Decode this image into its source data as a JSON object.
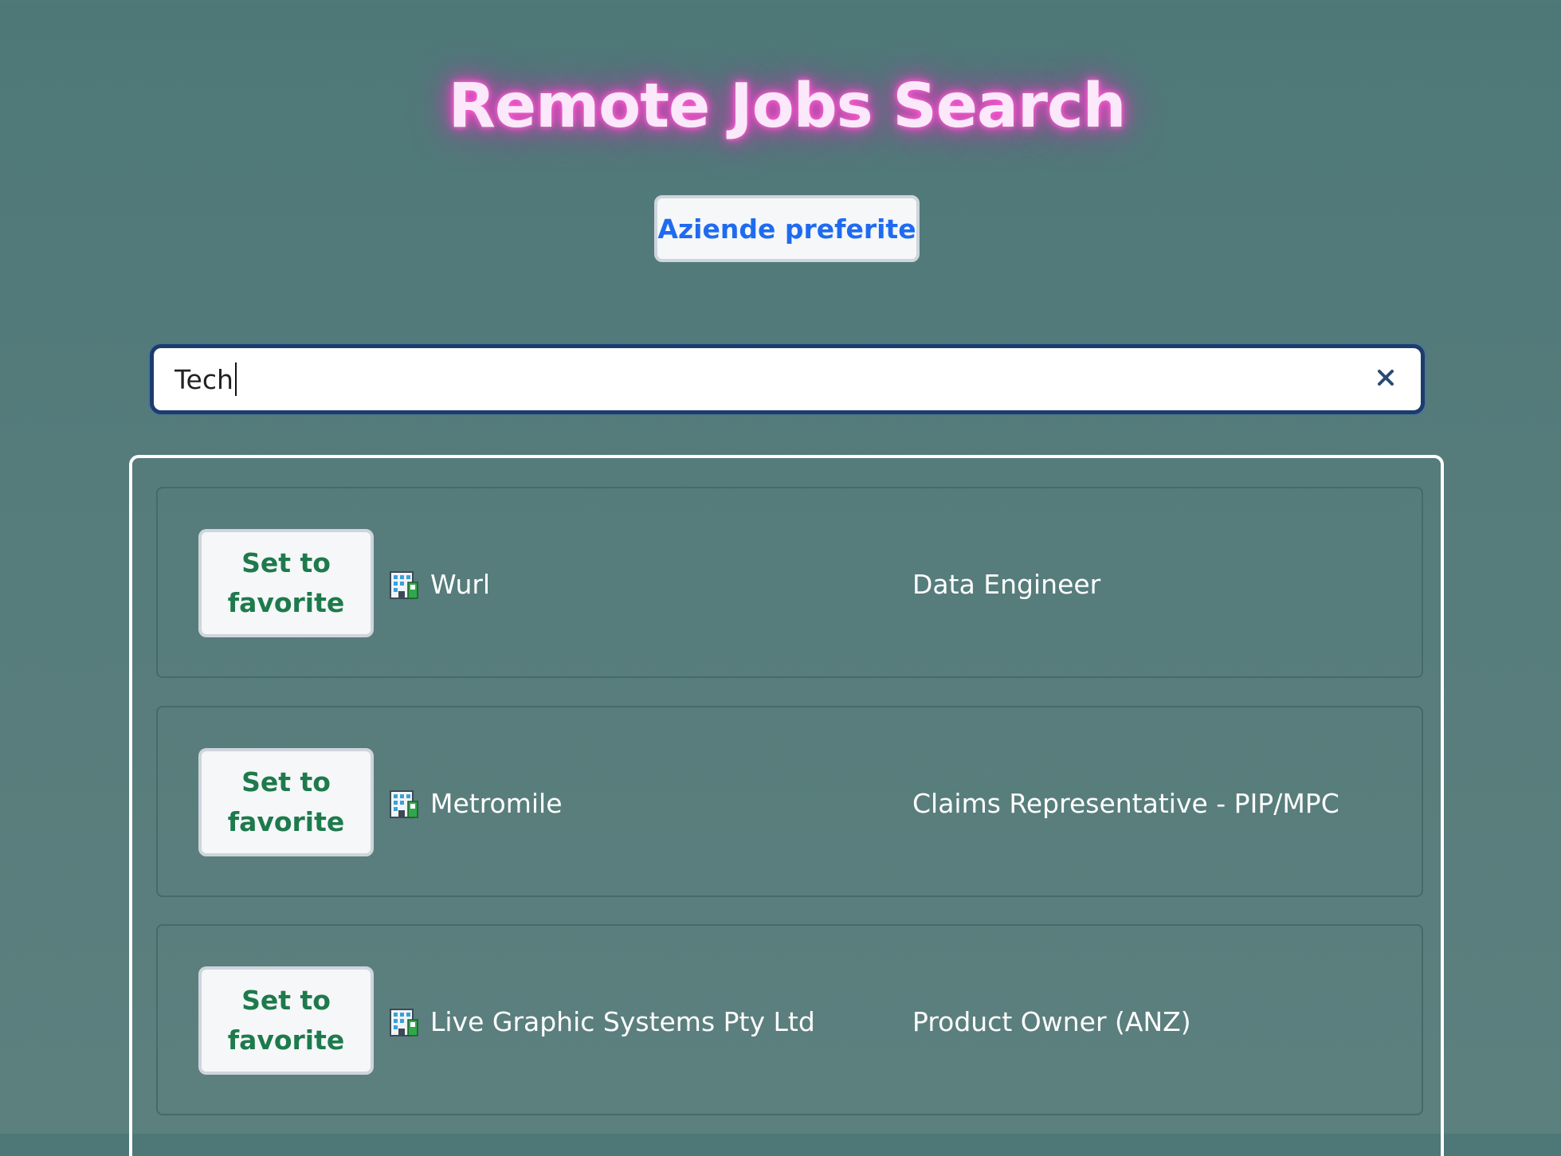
{
  "header": {
    "title": "Remote Jobs Search",
    "favorites_button_label": "Aziende preferite"
  },
  "search": {
    "value": "Tech",
    "clear_icon": "close-icon"
  },
  "jobs": [
    {
      "favorite_label": "Set to favorite",
      "company_icon": "office-building-icon",
      "company": "Wurl",
      "title": "Data Engineer"
    },
    {
      "favorite_label": "Set to favorite",
      "company_icon": "office-building-icon",
      "company": "Metromile",
      "title": "Claims Representative - PIP/MPC"
    },
    {
      "favorite_label": "Set to favorite",
      "company_icon": "office-building-icon",
      "company": "Live Graphic Systems Pty Ltd",
      "title": "Product Owner (ANZ)"
    }
  ],
  "colors": {
    "background": "#537b7a",
    "title_glow": "#ff4fd0",
    "favorites_text": "#1f6bf0",
    "favorite_button_text": "#1e7a4c",
    "search_border": "#1c3c6c"
  }
}
